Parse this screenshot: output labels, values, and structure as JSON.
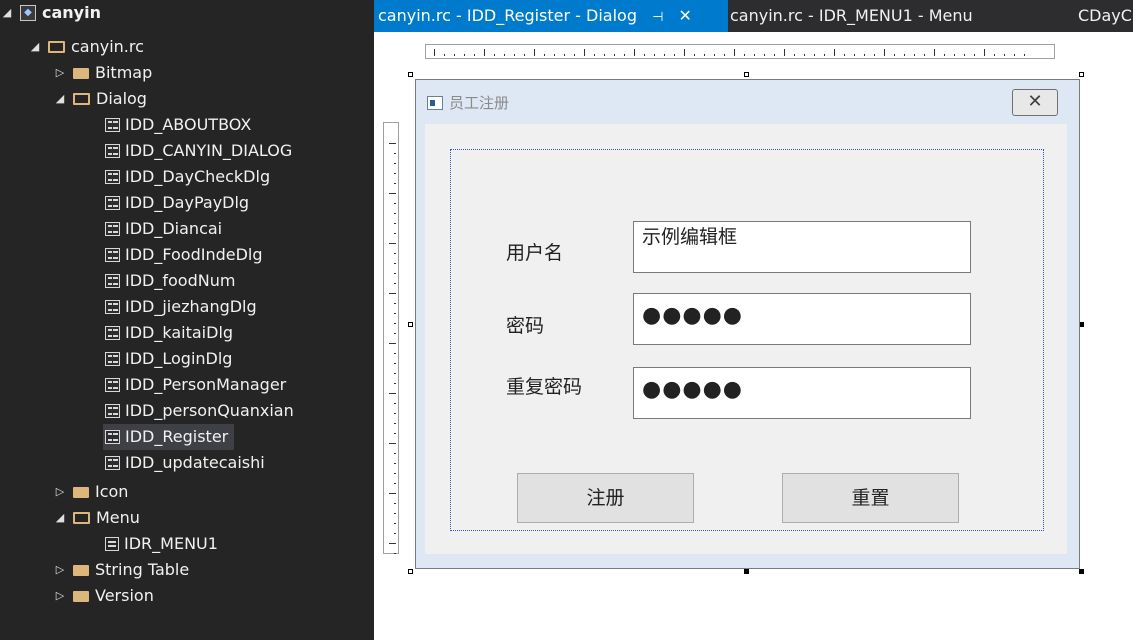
{
  "tree": {
    "project": "canyin",
    "rc_file": "canyin.rc",
    "folders": {
      "bitmap": "Bitmap",
      "dialog": "Dialog",
      "icon": "Icon",
      "menu": "Menu",
      "string_table": "String Table",
      "version": "Version"
    },
    "dialogs": [
      "IDD_ABOUTBOX",
      "IDD_CANYIN_DIALOG",
      "IDD_DayCheckDlg",
      "IDD_DayPayDlg",
      "IDD_Diancai",
      "IDD_FoodIndeDlg",
      "IDD_foodNum",
      "IDD_jiezhangDlg",
      "IDD_kaitaiDlg",
      "IDD_LoginDlg",
      "IDD_PersonManager",
      "IDD_personQuanxian",
      "IDD_Register",
      "IDD_updatecaishi"
    ],
    "selected": "IDD_Register",
    "menus": [
      "IDR_MENU1"
    ]
  },
  "tabs": [
    {
      "label": "canyin.rc - IDD_Register - Dialog",
      "pin": "⊣",
      "close": "✕"
    },
    {
      "label": "canyin.rc - IDR_MENU1 - Menu"
    },
    {
      "label": "CDayCh"
    }
  ],
  "dialog": {
    "title": "员工注册",
    "close_glyph": "✕",
    "labels": {
      "username": "用户名",
      "password": "密码",
      "repeat_password": "重复密码"
    },
    "fields": {
      "username_value": "示例编辑框",
      "password_value": "●●●●●",
      "repeat_password_value": "●●●●●"
    },
    "buttons": {
      "register": "注册",
      "reset": "重置"
    }
  }
}
